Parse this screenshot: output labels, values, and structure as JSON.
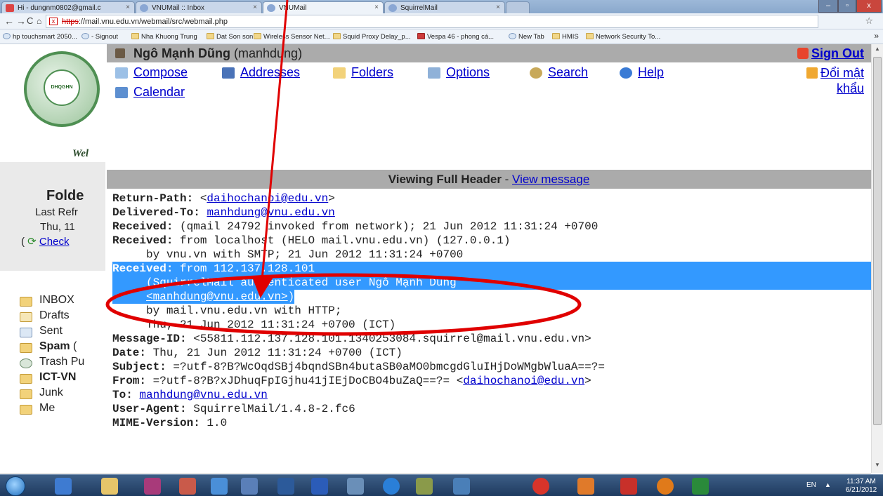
{
  "browser": {
    "tabs": [
      {
        "title": "Hi - dungnm0802@gmail.c"
      },
      {
        "title": "VNUMail :: Inbox"
      },
      {
        "title": "VNUMail"
      },
      {
        "title": "SquirrelMail"
      }
    ],
    "url_scheme": "https",
    "url_rest": "://mail.vnu.edu.vn/webmail/src/webmail.php",
    "bookmarks": [
      {
        "label": "hp touchsmart 2050...",
        "icon": "page-icon"
      },
      {
        "label": "- Signout",
        "icon": "page-icon"
      },
      {
        "label": "Nha Khuong Trung",
        "icon": "folder-icon"
      },
      {
        "label": "Dat Son son",
        "icon": "folder-icon"
      },
      {
        "label": "Wireless Sensor Net...",
        "icon": "folder-icon"
      },
      {
        "label": "Squid Proxy Delay_p...",
        "icon": "folder-icon"
      },
      {
        "label": "Vespa 46 - phong cá...",
        "icon": "red-page-icon"
      },
      {
        "label": "New Tab",
        "icon": "page-icon"
      },
      {
        "label": "HMIS",
        "icon": "folder-icon"
      },
      {
        "label": "Network Security To...",
        "icon": "folder-icon"
      }
    ],
    "bookmarks_more": "»"
  },
  "sidebar": {
    "welcome": "Wel",
    "folders_title": "Folde",
    "last_refresh": "Last Refr",
    "refresh_time": "Thu, 11",
    "check_mail_prefix": "( ",
    "check_mail": "Check",
    "folders": [
      {
        "label": "INBOX",
        "bold": false,
        "extra": ""
      },
      {
        "label": "Drafts",
        "bold": false,
        "extra": ""
      },
      {
        "label": "Sent",
        "bold": false,
        "extra": ""
      },
      {
        "label": "Spam",
        "bold": true,
        "extra": " ("
      },
      {
        "label": "Trash",
        "bold": false,
        "extra": " Pu"
      },
      {
        "label": "ICT-VN",
        "bold": true,
        "extra": ""
      },
      {
        "label": "Junk",
        "bold": false,
        "extra": ""
      },
      {
        "label": "Me",
        "bold": false,
        "extra": ""
      }
    ]
  },
  "userbar": {
    "name": "Ngô Mạnh Dũng",
    "login": "(manhdung)",
    "sign_out": "Sign Out"
  },
  "menu": {
    "compose": "Compose",
    "addresses": "Addresses",
    "folders": "Folders",
    "options": "Options",
    "search": "Search",
    "help": "Help",
    "calendar": "Calendar",
    "change_password_1": "Đổi mật",
    "change_password_2": "khẩu"
  },
  "viewer": {
    "title": "Viewing Full Header",
    "separator": " - ",
    "view_message": "View message"
  },
  "headers": {
    "return_path_label": "Return-Path:",
    "return_path_pre": " <",
    "return_path_link": "daihochanoi@edu.vn",
    "return_path_post": ">",
    "delivered_to_label": "Delivered-To:",
    "delivered_to_link": "manhdung@vnu.edu.vn",
    "received1_label": "Received:",
    "received1_value": " (qmail 24792 invoked from network); 21 Jun 2012 11:31:24 +0700",
    "received2_label": "Received:",
    "received2_value": " from localhost (HELO mail.vnu.edu.vn) (127.0.0.1)",
    "received2_cont": "     by vnu.vn with SMTP; 21 Jun 2012 11:31:24 +0700",
    "received3_label": "Received:",
    "received3_value": " from 112.137.128.101",
    "received3_cont1": "     (SquirrelMail authenticated user Ngô Mạnh Dũng",
    "received3_cont2_pre": "     ",
    "received3_cont2_link": "<manhdung@vnu.edu.vn>",
    "received3_cont2_post": ")",
    "received3_cont3": "     by mail.vnu.edu.vn with HTTP;",
    "received3_cont4": "     Thu, 21 Jun 2012 11:31:24 +0700 (ICT)",
    "message_id_label": "Message-ID:",
    "message_id_value": " <55811.112.137.128.101.1340253084.squirrel@mail.vnu.edu.vn>",
    "date_label": "Date:",
    "date_value": " Thu, 21 Jun 2012 11:31:24 +0700 (ICT)",
    "subject_label": "Subject:",
    "subject_value": " =?utf-8?B?WcOqdSBj4bqndSBn4butaSB0aMO0bmcgdGluIHjDoWMgbWluaA==?=",
    "from_label": "From:",
    "from_value": " =?utf-8?B?xJDhuqFpIGjhu41jIEjDoCBO4buZaQ==?= <",
    "from_link": "daihochanoi@edu.vn",
    "from_post": ">",
    "to_label": "To:",
    "to_link": "manhdung@vnu.edu.vn",
    "user_agent_label": "User-Agent:",
    "user_agent_value": " SquirrelMail/1.4.8-2.fc6",
    "mime_label": "MIME-Version:",
    "mime_value": " 1.0"
  },
  "taskbar": {
    "lang": "EN",
    "time": "11:37 AM",
    "date": "6/21/2012"
  },
  "colors": {
    "selection": "#3399ff",
    "annotation": "#e00000",
    "link": "#0000cc",
    "bar_gray": "#ababab"
  }
}
